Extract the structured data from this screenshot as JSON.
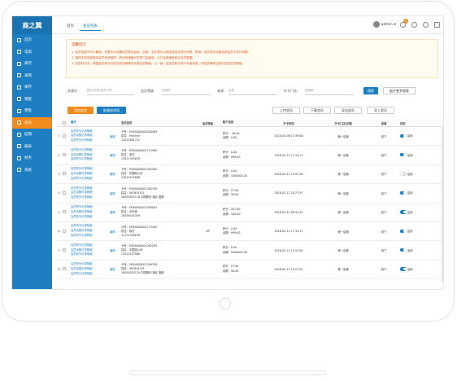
{
  "logo": "商之翼",
  "nav": [
    "首页",
    "电商",
    "库存",
    "采购",
    "库存",
    "销售",
    "零售",
    "会员",
    "促销",
    "报表",
    "财务",
    "系统"
  ],
  "nav_active": 7,
  "tabs": {
    "home": "首页",
    "current": "会员列表"
  },
  "user": {
    "name": "admin",
    "badge": "1"
  },
  "tip": {
    "title": "温馨提示",
    "lines": [
      "1. 会员信息不可以删除，但是可以设置会员是否启用，启用：会员将可以使用该会员进行消费，禁用：会员将无法使用该会员卡进行消费。",
      "2. 相同手机号将被本会员系统维护，积分和储值可在同门店使用，以门店维度来统计会员数据。",
      "3. 会员积分可，根据会员积分及积分变动等情况计算会员等级，上一级：若会员积分低于升级标准，则会员降到当前对应的会员等级。"
    ]
  },
  "filter": {
    "kw_label": "关键字：",
    "kw_ph": "姓名/手机/会员卡号",
    "level_label": "会员等级：",
    "level_val": "请选择",
    "source_label": "来源：",
    "source_val": "全部",
    "store_label": "开卡门店：",
    "store_val": "请选择",
    "search": "搜索",
    "more": "展开更多搜索"
  },
  "actions": {
    "add": "添加会员",
    "batch": "批量给字段",
    "upload": "上传会员",
    "download": "下载会员",
    "export": "导出会员",
    "import": "导入会员"
  },
  "headers": [
    "",
    "",
    "操作",
    "",
    "会员信息",
    "会员等级",
    "账户信息",
    "开卡时间",
    "开卡门店/店铺",
    "来源",
    "状态"
  ],
  "op_a": "会员积分记录明细",
  "op_b": "会员余额记录明细",
  "edit": "编辑",
  "rows": [
    {
      "no": "1",
      "card": "卡号：M5E0000000026469",
      "name": "姓名：Mhhhhh",
      "phone": "13015661741",
      "level": "",
      "pts": "积分：-50.00",
      "bal": "余额：0.00",
      "time": "2018-05-08 15:39:06",
      "store": "第一店铺",
      "src": "线下",
      "status": "启用",
      "on": true
    },
    {
      "no": "2",
      "card": "卡号：M5E0000001173485",
      "name": "姓名：测试",
      "phone": "13812345678",
      "level": "",
      "pts": "积分：0.00",
      "bal": "余额：999.00",
      "time": "2018-03-12 17:19:13",
      "store": "第一店铺",
      "src": "线下",
      "status": "启用",
      "on": true
    },
    {
      "no": "3",
      "card": "卡号：M5E0000001282285",
      "name": "姓名：中国网公司",
      "phone": "13012457888",
      "level": "",
      "pts": "积分：0.00",
      "bal": "余额：1000000.00",
      "time": "2018-03-12 13:52:58",
      "store": "第一店铺",
      "src": "线下",
      "status": "启用",
      "on": false
    },
    {
      "no": "4",
      "card": "卡号：M5E0000001300709",
      "name": "姓名：987654321",
      "phone": "18030852120  中国移动  湖北  襄樊",
      "level": "",
      "pts": "积分：57.00",
      "bal": "余额：58.00",
      "time": "2018-03-12 10:27:55",
      "store": "第一店铺",
      "src": "线下",
      "status": "启用",
      "on": true
    },
    {
      "no": "5",
      "card": "卡号：M5E0000001300803",
      "name": "姓名：请升级",
      "phone": "18338402309",
      "level": "",
      "pts": "积分：207.00",
      "bal": "余额：100.00",
      "time": "2018-03-12 09:41:35",
      "store": "第一店铺",
      "src": "线下",
      "status": "启用",
      "on": true
    },
    {
      "no": "6",
      "card": "卡号：M5E0000001173485",
      "name": "姓名：测试",
      "phone": "15112345678",
      "level": "VIP",
      "pts": "积分：0.00",
      "bal": "余额：999.00",
      "time": "2018-03-12 17:19:13",
      "store": "第一店铺",
      "src": "线下",
      "status": "启用",
      "on": true
    },
    {
      "no": "7",
      "card": "卡号：M5E0000001282285",
      "name": "姓名：中国网公司",
      "phone": "13012457888",
      "level": "",
      "pts": "积分：0.00",
      "bal": "余额：1000000.00",
      "time": "2018-03-12 13:52:58",
      "store": "第一店铺",
      "src": "线下",
      "status": "启用",
      "on": true
    },
    {
      "no": "8",
      "card": "卡号：M5E0000001300709",
      "name": "姓名：987654321",
      "phone": "18030852120  中国移动  湖北  襄樊",
      "level": "",
      "pts": "积分：57.00",
      "bal": "余额：58.00",
      "time": "2018-03-12 10:27:55",
      "store": "第一店铺",
      "src": "线下",
      "status": "启用",
      "on": true
    }
  ]
}
